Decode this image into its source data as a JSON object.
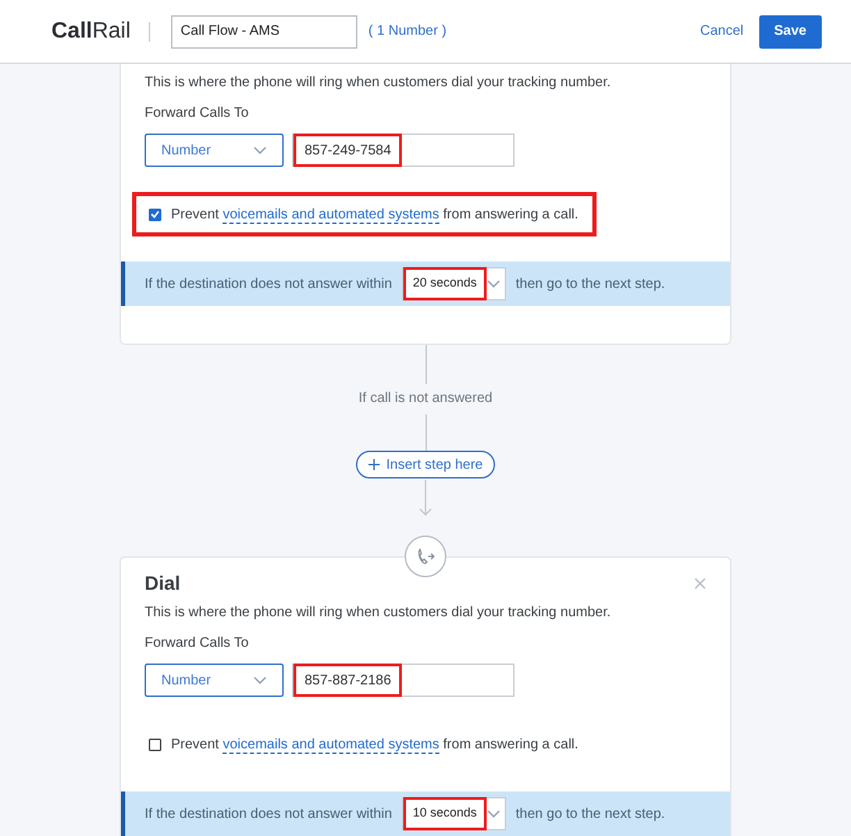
{
  "header": {
    "logo": "**Call**Rail",
    "flow_name": "Call Flow - AMS",
    "number_count": "( 1 Number )",
    "cancel": "Cancel",
    "save": "Save"
  },
  "steps": [
    {
      "description": "This is where the phone will ring when customers dial your tracking number.",
      "forward_label": "Forward Calls To",
      "type_select": "Number",
      "phone": "857-249-7584",
      "phone_highlighted": true,
      "prevent": {
        "checked": true,
        "highlighted": true,
        "before": "Prevent",
        "link": "voicemails and automated systems",
        "after": "from answering a call."
      },
      "timeout": {
        "before": "If the destination does not answer within",
        "value": "20 seconds",
        "after": "then go to the next step.",
        "highlighted": true
      }
    },
    {
      "title": "Dial",
      "closable": true,
      "description": "This is where the phone will ring when customers dial your tracking number.",
      "forward_label": "Forward Calls To",
      "type_select": "Number",
      "phone": "857-887-2186",
      "phone_highlighted": true,
      "prevent": {
        "checked": false,
        "highlighted": false,
        "before": "Prevent",
        "link": "voicemails and automated systems",
        "after": "from answering a call."
      },
      "timeout": {
        "before": "If the destination does not answer within",
        "value": "10 seconds",
        "after": "then go to the next step.",
        "highlighted": true
      }
    }
  ],
  "connector": {
    "label": "If call is not answered",
    "insert_button": "Insert step here"
  }
}
